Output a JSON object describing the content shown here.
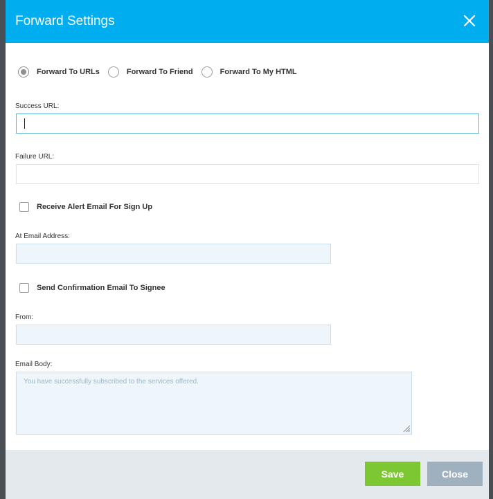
{
  "dialog": {
    "title": "Forward Settings"
  },
  "forward_options": [
    {
      "label": "Forward To URLs",
      "checked": true
    },
    {
      "label": "Forward To Friend",
      "checked": false
    },
    {
      "label": "Forward To My HTML",
      "checked": false
    }
  ],
  "success_url": {
    "label": "Success URL:",
    "value": ""
  },
  "failure_url": {
    "label": "Failure URL:",
    "value": ""
  },
  "alert_email": {
    "label": "Receive Alert Email For Sign Up",
    "checked": false
  },
  "at_email": {
    "label": "At Email Address:",
    "value": ""
  },
  "confirmation_email": {
    "label": "Send Confirmation Email To Signee",
    "checked": false
  },
  "from": {
    "label": "From:",
    "value": ""
  },
  "email_body": {
    "label": "Email Body:",
    "placeholder": "You have successfully subscribed to the services offered."
  },
  "footer": {
    "save_label": "Save",
    "close_label": "Close"
  },
  "colors": {
    "header": "#00aeef",
    "save": "#7dc832",
    "close": "#9fb0be"
  }
}
